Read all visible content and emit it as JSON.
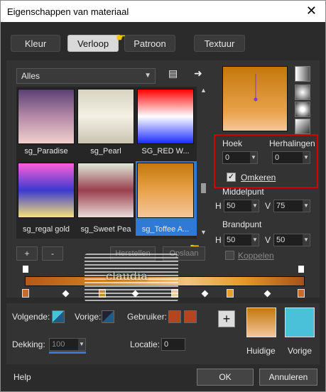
{
  "window": {
    "title": "Eigenschappen van materiaal",
    "close": "✕"
  },
  "tabs": [
    {
      "label": "Kleur"
    },
    {
      "label": "Verloop"
    },
    {
      "label": "Patroon"
    },
    {
      "label": "Textuur"
    }
  ],
  "library": {
    "dropdown_value": "Alles",
    "items": [
      {
        "label": "sg_Paradise",
        "colors": [
          "#5b3f73",
          "#b58aa8",
          "#f0d0cc"
        ]
      },
      {
        "label": "sg_Pearl",
        "colors": [
          "#d8d4c0",
          "#f4f0e4",
          "#c9c4b0"
        ]
      },
      {
        "label": "SG_RED W...",
        "colors": [
          "#ff0000",
          "#ffffff",
          "#1a2bff"
        ]
      },
      {
        "label": "sg_regal gold",
        "colors": [
          "#ff5fd8",
          "#3a3ad0",
          "#f7e27a"
        ]
      },
      {
        "label": "sg_Sweet Pea",
        "colors": [
          "#dfe9d9",
          "#9a3f4e",
          "#e9ddd8"
        ]
      },
      {
        "label": "sg_Toffee A...",
        "colors": [
          "#c4780b",
          "#e9a24a",
          "#f4c79b"
        ]
      }
    ],
    "add": "+",
    "remove": "-",
    "save_disabled": "Herstellen",
    "save2_disabled": "Opslaan"
  },
  "settings": {
    "hoek_label": "Hoek",
    "hoek_value": "0",
    "herhalingen_label": "Herhalingen",
    "herhalingen_value": "0",
    "omkeren_label": "Omkeren",
    "omkeren_checked": true,
    "middelpunt_label": "Middelpunt",
    "mid_h_label": "H",
    "mid_h": "50",
    "mid_v_label": "V",
    "mid_v": "75",
    "brandpunt_label": "Brandpunt",
    "bp_h_label": "H",
    "bp_h": "50",
    "bp_v_label": "V",
    "bp_v": "50",
    "koppelen_label": "Koppelen"
  },
  "bottom": {
    "volgende_label": "Volgende:",
    "vorige_label": "Vorige:",
    "gebruiker_label": "Gebruiker:",
    "dekking_label": "Dekking:",
    "dekking_value": "100",
    "locatie_label": "Locatie:",
    "locatie_value": "0",
    "add": "+",
    "huidige_label": "Huidige",
    "vorige2_label": "Vorige",
    "current_color": "#c4780b",
    "previous_color": "#4bc0d9"
  },
  "footer": {
    "help": "Help",
    "ok": "OK",
    "cancel": "Annuleren"
  },
  "watermark": {
    "text": "claudia"
  }
}
